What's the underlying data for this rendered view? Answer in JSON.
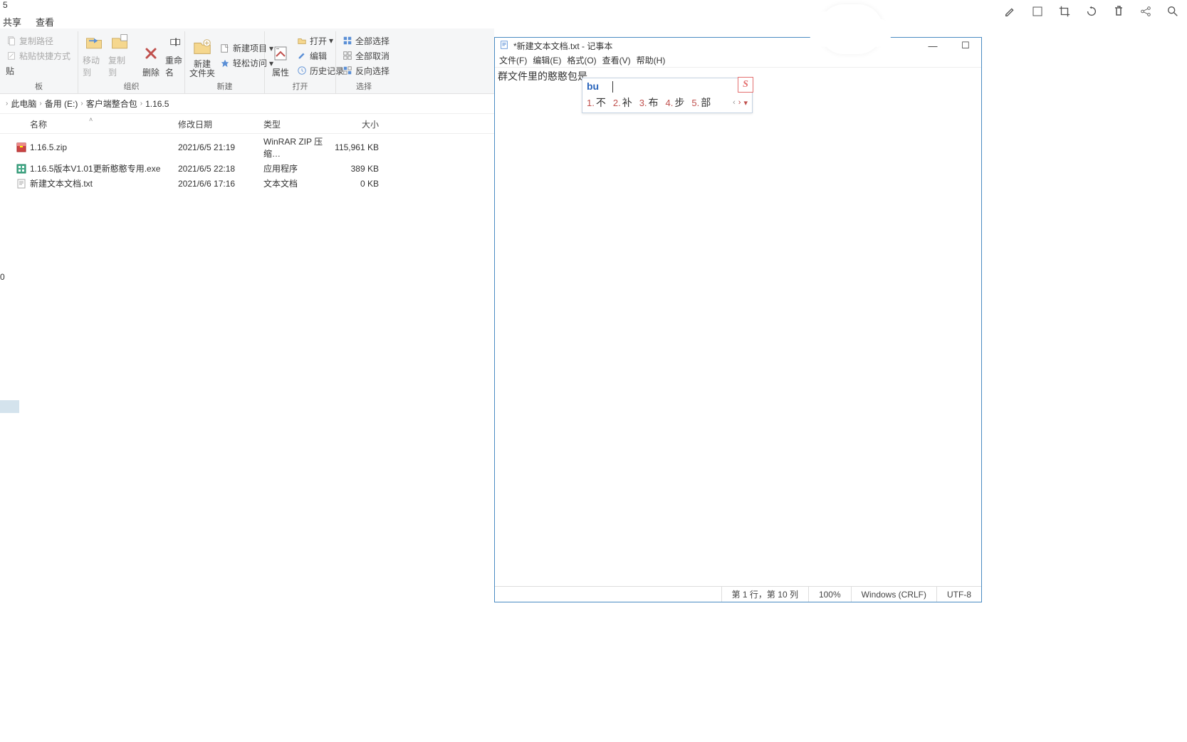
{
  "explorer": {
    "tab_name": "5",
    "tabs": {
      "share": "共享",
      "view": "查看"
    },
    "ribbon": {
      "clipboard": {
        "label": "板",
        "copy_path": "复制路径",
        "paste_shortcut": "粘贴快捷方式",
        "cut": "贴"
      },
      "organize": {
        "label": "组织",
        "move_to": "移动到",
        "copy_to": "复制到",
        "delete": "删除",
        "rename": "重命名"
      },
      "new": {
        "label": "新建",
        "new_folder": "新建\n文件夹",
        "new_item": "新建项目",
        "easy_access": "轻松访问"
      },
      "open": {
        "label": "打开",
        "properties": "属性",
        "open": "打开",
        "edit": "编辑",
        "history": "历史记录"
      },
      "select": {
        "label": "选择",
        "select_all": "全部选择",
        "select_none": "全部取消",
        "invert": "反向选择"
      }
    },
    "breadcrumb": [
      "此电脑",
      "备用 (E:)",
      "客户端整合包",
      "1.16.5"
    ],
    "columns": {
      "name": "名称",
      "date": "修改日期",
      "type": "类型",
      "size": "大小"
    },
    "files": [
      {
        "icon": "zip",
        "name": "1.16.5.zip",
        "date": "2021/6/5 21:19",
        "type": "WinRAR ZIP 压缩…",
        "size": "115,961 KB"
      },
      {
        "icon": "exe",
        "name": "1.16.5版本V1.01更新憨憨专用.exe",
        "date": "2021/6/5 22:18",
        "type": "应用程序",
        "size": "389 KB"
      },
      {
        "icon": "txt",
        "name": "新建文本文档.txt",
        "date": "2021/6/6 17:16",
        "type": "文本文档",
        "size": "0 KB"
      }
    ],
    "side_count": "0"
  },
  "notepad": {
    "title": "*新建文本文档.txt - 记事本",
    "menu": {
      "file": "文件(F)",
      "edit": "编辑(E)",
      "format": "格式(O)",
      "view": "查看(V)",
      "help": "帮助(H)"
    },
    "content": "群文件里的憨憨包是",
    "status": {
      "pos": "第 1 行，第 10 列",
      "zoom": "100%",
      "eol": "Windows (CRLF)",
      "encoding": "UTF-8"
    }
  },
  "ime": {
    "input": "bu",
    "candidates": [
      {
        "n": "1.",
        "ch": "不"
      },
      {
        "n": "2.",
        "ch": "补"
      },
      {
        "n": "3.",
        "ch": "布"
      },
      {
        "n": "4.",
        "ch": "步"
      },
      {
        "n": "5.",
        "ch": "部"
      }
    ],
    "logo": "S"
  }
}
